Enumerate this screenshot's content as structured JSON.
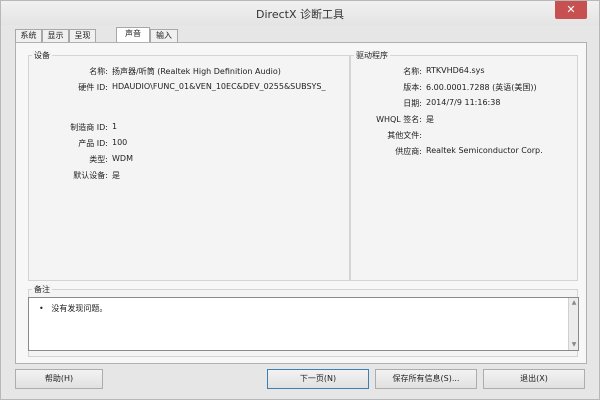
{
  "window": {
    "title": "DirectX 诊断工具",
    "close_glyph": "✕"
  },
  "tabs": [
    {
      "label": "系统"
    },
    {
      "label": "显示"
    },
    {
      "label": "呈现"
    },
    {
      "label": "声音",
      "active": true
    },
    {
      "label": "输入"
    }
  ],
  "device": {
    "section_title": "设备",
    "name_label": "名称:",
    "name_value": "扬声器/听筒 (Realtek High Definition Audio)",
    "hardware_id_label": "硬件 ID:",
    "hardware_id_value": "HDAUDIO\\FUNC_01&VEN_10EC&DEV_0255&SUBSYS_",
    "manufacturer_id_label": "制造商 ID:",
    "manufacturer_id_value": "1",
    "product_id_label": "产品 ID:",
    "product_id_value": "100",
    "type_label": "类型:",
    "type_value": "WDM",
    "default_device_label": "默认设备:",
    "default_device_value": "是"
  },
  "driver": {
    "section_title": "驱动程序",
    "name_label": "名称:",
    "name_value": "RTKVHD64.sys",
    "version_label": "版本:",
    "version_value": "6.00.0001.7288 (英语(美国))",
    "date_label": "日期:",
    "date_value": "2014/7/9 11:16:38",
    "whql_label": "WHQL 签名:",
    "whql_value": "是",
    "other_files_label": "其他文件:",
    "other_files_value": "",
    "provider_label": "供应商:",
    "provider_value": "Realtek Semiconductor Corp."
  },
  "notes": {
    "section_title": "备注",
    "items": [
      "没有发现问题。"
    ]
  },
  "buttons": {
    "help": "帮助(H)",
    "next_page": "下一页(N)",
    "save_all": "保存所有信息(S)...",
    "exit": "退出(X)"
  }
}
